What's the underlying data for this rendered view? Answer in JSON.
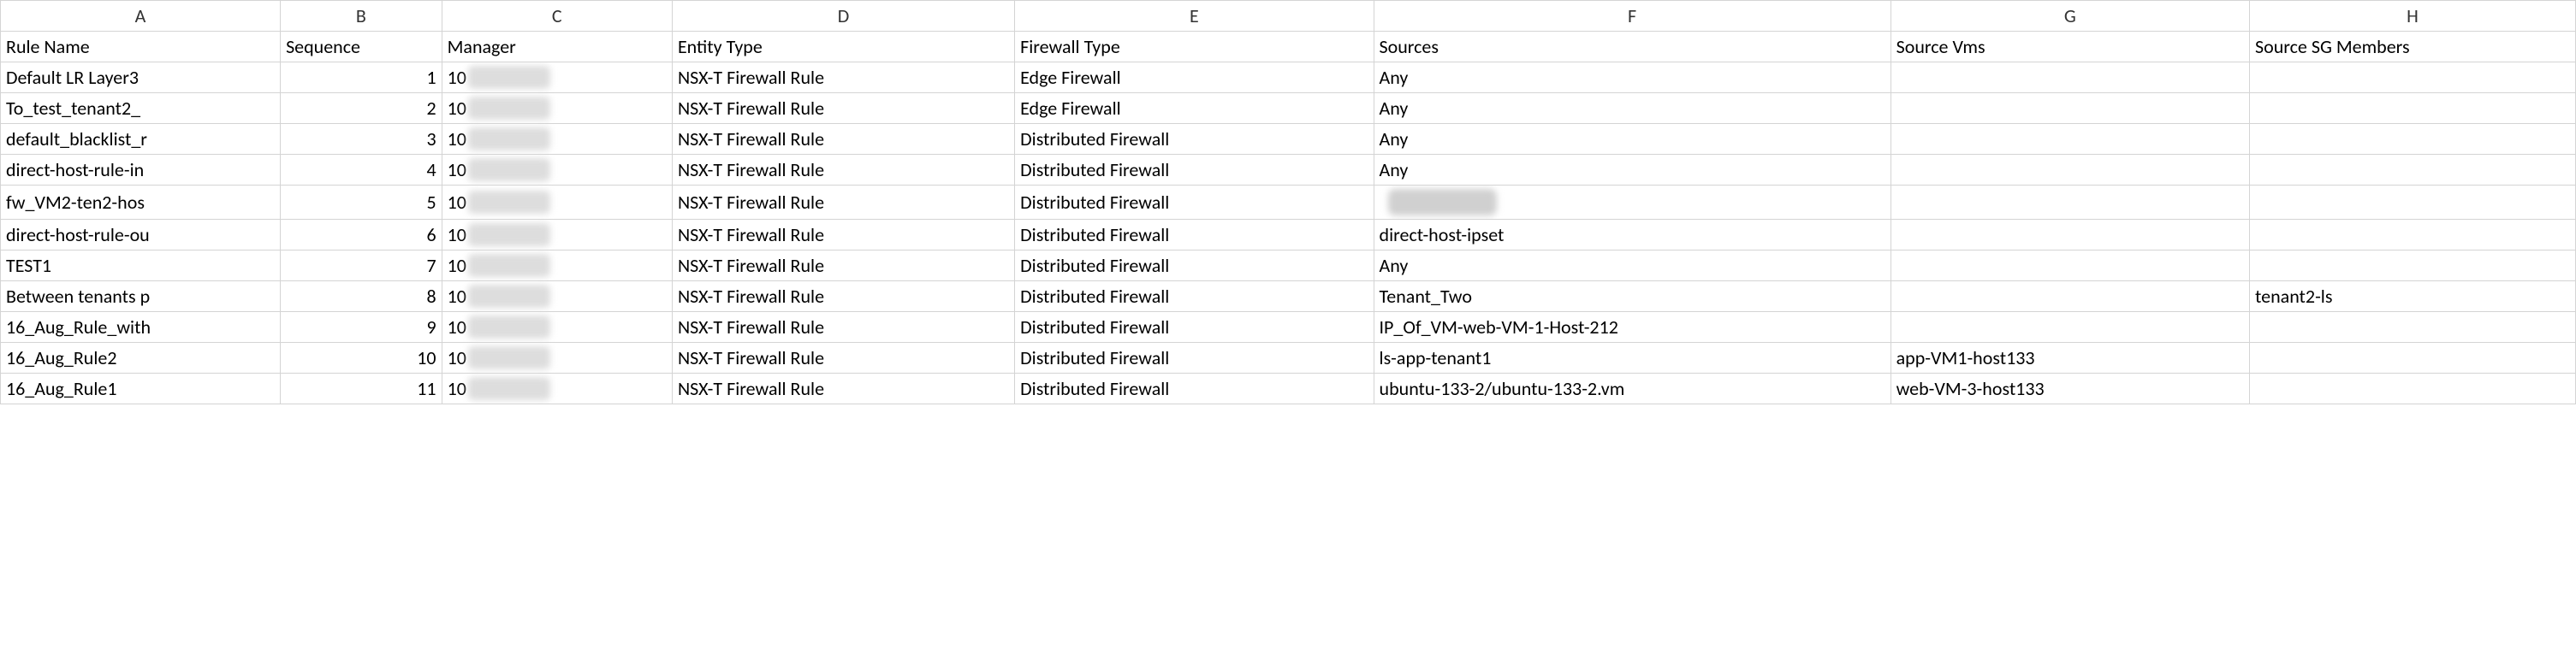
{
  "columns": [
    "A",
    "B",
    "C",
    "D",
    "E",
    "F",
    "G",
    "H"
  ],
  "headers": {
    "a": "Rule Name",
    "b": "Sequence",
    "c": "Manager",
    "d": "Entity Type",
    "e": "Firewall Type",
    "f": "Sources",
    "g": "Source Vms",
    "h": "Source SG Members"
  },
  "manager_prefix": "10",
  "rows": [
    {
      "a": "Default LR Layer3",
      "b": "1",
      "d": "NSX-T Firewall Rule",
      "e": "Edge Firewall",
      "f": "Any",
      "g": "",
      "h": "",
      "c_blurred": true
    },
    {
      "a": "To_test_tenant2_",
      "b": "2",
      "d": "NSX-T Firewall Rule",
      "e": "Edge Firewall",
      "f": "Any",
      "g": "",
      "h": "",
      "c_blurred": true
    },
    {
      "a": "default_blacklist_r",
      "b": "3",
      "d": "NSX-T Firewall Rule",
      "e": "Distributed Firewall",
      "f": "Any",
      "g": "",
      "h": "",
      "c_blurred": true
    },
    {
      "a": "direct-host-rule-in",
      "b": "4",
      "d": "NSX-T Firewall Rule",
      "e": "Distributed Firewall",
      "f": "Any",
      "g": "",
      "h": "",
      "c_blurred": true
    },
    {
      "a": "fw_VM2-ten2-hos",
      "b": "5",
      "d": "NSX-T Firewall Rule",
      "e": "Distributed Firewall",
      "f": "",
      "f_blurred": true,
      "g": "",
      "h": "",
      "c_blurred": true
    },
    {
      "a": "direct-host-rule-ou",
      "b": "6",
      "d": "NSX-T Firewall Rule",
      "e": "Distributed Firewall",
      "f": "direct-host-ipset",
      "g": "",
      "h": "",
      "c_blurred": true
    },
    {
      "a": "TEST1",
      "b": "7",
      "d": "NSX-T Firewall Rule",
      "e": "Distributed Firewall",
      "f": "Any",
      "g": "",
      "h": "",
      "c_blurred": true
    },
    {
      "a": "Between tenants p",
      "b": "8",
      "d": "NSX-T Firewall Rule",
      "e": "Distributed Firewall",
      "f": "Tenant_Two",
      "g": "",
      "h": "tenant2-ls",
      "c_blurred": true
    },
    {
      "a": "16_Aug_Rule_with",
      "b": "9",
      "d": "NSX-T Firewall Rule",
      "e": "Distributed Firewall",
      "f": "IP_Of_VM-web-VM-1-Host-212",
      "g": "",
      "h": "",
      "c_blurred": true
    },
    {
      "a": "16_Aug_Rule2",
      "b": "10",
      "d": "NSX-T Firewall Rule",
      "e": "Distributed Firewall",
      "f": "ls-app-tenant1",
      "g": "app-VM1-host133",
      "h": "",
      "c_blurred": true
    },
    {
      "a": "16_Aug_Rule1",
      "b": "11",
      "d": "NSX-T Firewall Rule",
      "e": "Distributed Firewall",
      "f": "ubuntu-133-2/ubuntu-133-2.vm",
      "g": "web-VM-3-host133",
      "h": "",
      "c_blurred": true
    }
  ]
}
